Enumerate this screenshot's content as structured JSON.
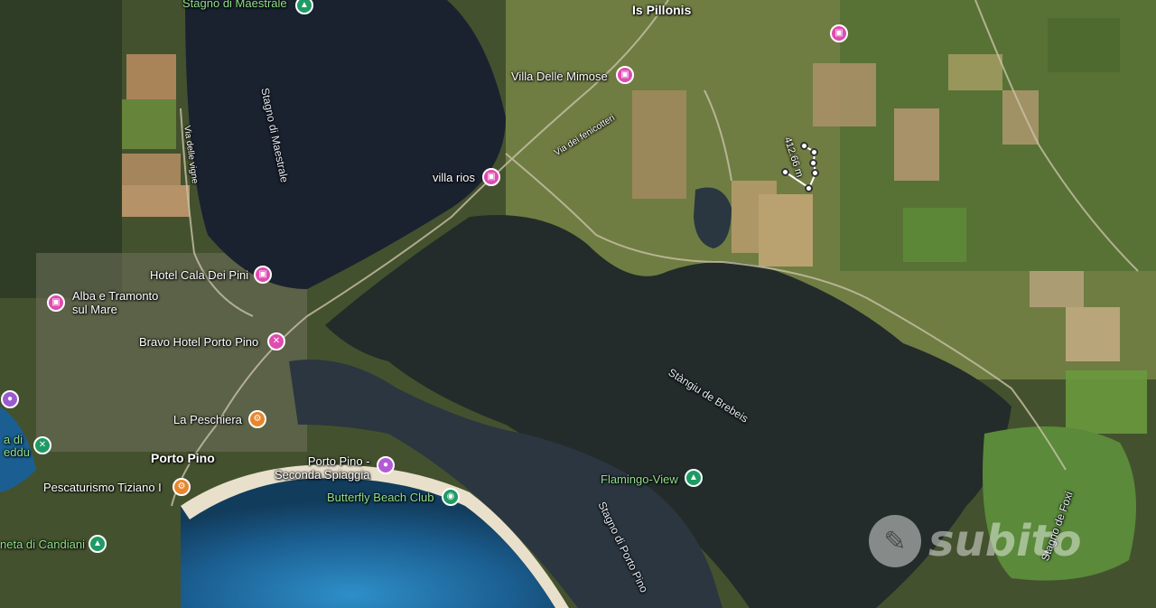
{
  "labels": {
    "stagno_maestrale_top": "Stagno di Maestrale",
    "is_pillonis": "Is Pillonis",
    "stagno_maestrale_water": "Stagno di Maestrale",
    "villa_mimose": "Villa Delle Mimose",
    "via_fenicotteri": "Via dei fenicotteri",
    "via_vigne": "Via delle vigne",
    "villa_rios": "villa rios",
    "hotel_cala_pini": "Hotel Cala Dei Pini",
    "alba_tramonto": "Alba e Tramonto\nsul Mare",
    "bravo_hotel": "Bravo Hotel Porto Pino",
    "stangiu_brebeis": "Stàngiu de Brebeis",
    "la_peschiera": "La Peschiera",
    "porto_pino": "Porto Pino",
    "porto_pino_seconda": "Porto Pino -\nSeconda Spiaggia",
    "butterfly": "Butterfly Beach Club",
    "flamingo": "Flamingo-View",
    "pescaturismo": "Pescaturismo Tiziano I",
    "stagno_porto_pino": "Stagno di Porto Pino",
    "stagno_foxi": "Stagno de Foxi",
    "pineta_candiani": "neta di Candiani",
    "left_edge_1": "a di",
    "left_edge_2": "eddu",
    "measure": "412.66 m",
    "watermark": "subito"
  },
  "icons": {
    "hotel": "bed-icon",
    "food": "fork-knife-icon",
    "poi": "tree-icon",
    "attraction": "camera-icon",
    "beach": "beach-club-icon",
    "resort": "crossed-tools-icon"
  },
  "colors": {
    "hotel_pin": "#e04bb0",
    "food_pin": "#e8862d",
    "poi_pin": "#1f9a64",
    "water": "#1a2535",
    "sea": "#1f6fa3",
    "farmland": "#6b7a3e",
    "dark_vegetation": "#2f3b2a"
  }
}
